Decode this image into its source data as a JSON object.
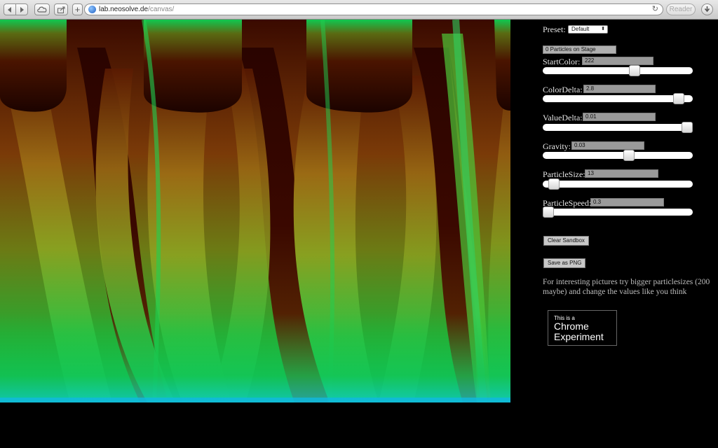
{
  "browser": {
    "url_host": "lab.neosolve.de",
    "url_path": "/canvas/",
    "reader_label": "Reader",
    "new_tab_label": "+"
  },
  "panel": {
    "preset_label": "Preset:",
    "preset_value": "Default",
    "particle_count": "0 Particles on Stage",
    "controls": [
      {
        "label": "StartColor:",
        "value": "222",
        "level": 0.62
      },
      {
        "label": "ColorDelta:",
        "value": "2.8",
        "level": 0.94
      },
      {
        "label": "ValueDelta:",
        "value": "0.01",
        "level": 1.0
      },
      {
        "label": "Gravity:",
        "value": "0.03",
        "level": 0.58
      },
      {
        "label": "ParticleSize:",
        "value": "13",
        "level": 0.04
      },
      {
        "label": "ParticleSpeed:",
        "value": "0.3",
        "level": 0.0
      }
    ],
    "clear_button": "Clear Sandbox",
    "save_button": "Save as PNG",
    "hint": "For interesting pictures try bigger particlesizes (200 maybe) and change the values like you think",
    "badge_small": "This is a",
    "badge_line1": "Chrome",
    "badge_line2": "Experiment"
  },
  "colors": {
    "canvas_dark": "#2a0600",
    "canvas_brown": "#7a4a12",
    "canvas_olive": "#7c8a1c",
    "canvas_green": "#18b83a",
    "canvas_cyan": "#00d8c8"
  }
}
